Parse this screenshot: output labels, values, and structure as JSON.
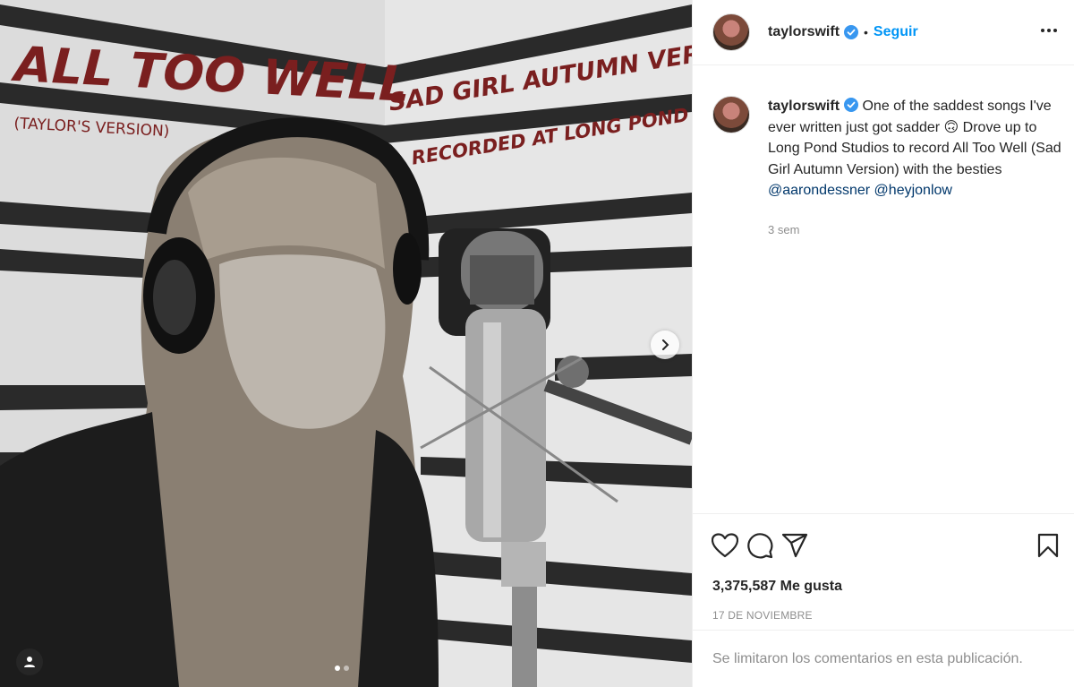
{
  "post": {
    "image_text": {
      "title": "ALL TOO WELL",
      "subtitle": "(TAYLOR'S VERSION)",
      "line1": "SAD GIRL AUTUMN VERSION",
      "line2": "RECORDED AT LONG POND STUDIOS"
    },
    "carousel": {
      "current": 1,
      "total": 2
    }
  },
  "header": {
    "username": "taylorswift",
    "separator": "•",
    "follow_label": "Seguir"
  },
  "caption": {
    "username": "taylorswift",
    "text_part1": "One of the saddest songs I've ever written just got sadder 🙃 Drove up to Long Pond Studios to record All Too Well (Sad Girl Autumn Version) with the besties ",
    "mention1": "@aarondessner",
    "mention2": "@heyjonlow",
    "time": "3 sem"
  },
  "stats": {
    "likes": "3,375,587 Me gusta",
    "date": "17 DE NOVIEMBRE"
  },
  "comments": {
    "disabled_notice": "Se limitaron los comentarios en esta publicación."
  },
  "icons": {
    "like": "heart-icon",
    "comment": "comment-icon",
    "share": "share-icon",
    "save": "bookmark-icon",
    "more": "more-icon",
    "verified": "verified-badge-icon",
    "next": "chevron-right-icon",
    "tag": "user-tag-icon"
  },
  "colors": {
    "accent": "#0095f6",
    "verified": "#3897f0",
    "overlay_text": "#7a1f1f"
  }
}
